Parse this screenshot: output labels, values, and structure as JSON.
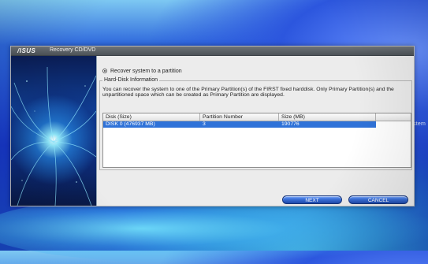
{
  "desktop": {
    "right_edge_text": "istem"
  },
  "window": {
    "title_brand": "/ISUS",
    "title": "Recovery CD/DVD"
  },
  "recovery_option": {
    "label": "Recover system to a partition"
  },
  "hard_disk_info": {
    "group_title": "Hard-Disk Information",
    "description": "You can recover the system to one of the Primary Partition(s) of the FIRST fixed harddisk. Only Primary Partition(s) and the unpartitioned space which can be created as Primary Partition are displayed."
  },
  "table": {
    "headers": [
      "Disk (Size)",
      "Partition Number",
      "Size (MB)"
    ],
    "rows": [
      [
        "DISK 0 (476937 MB)",
        "3",
        "190776"
      ]
    ]
  },
  "buttons": {
    "next": "NEXT",
    "cancel": "CANCEL"
  }
}
